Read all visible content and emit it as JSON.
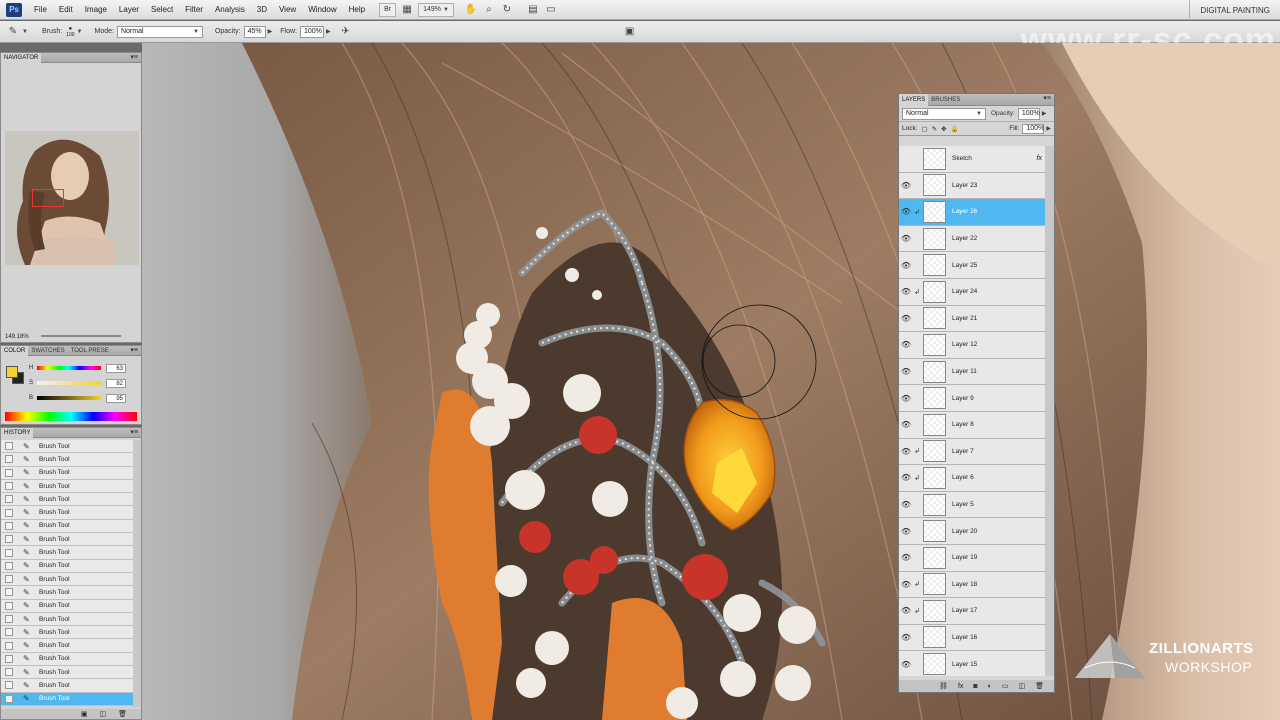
{
  "app": {
    "logo": "Ps",
    "workspace": "DIGITAL PAINTING",
    "watermark": "www.rr-sc.com"
  },
  "menu": [
    "File",
    "Edit",
    "Image",
    "Layer",
    "Select",
    "Filter",
    "Analysis",
    "3D",
    "View",
    "Window",
    "Help"
  ],
  "menubar_controls": {
    "br": "Br",
    "zoom": "149%"
  },
  "options": {
    "brush_label": "Brush:",
    "brush_size": "100",
    "mode_label": "Mode:",
    "mode_value": "Normal",
    "opacity_label": "Opacity:",
    "opacity_value": "45%",
    "flow_label": "Flow:",
    "flow_value": "100%"
  },
  "navigator": {
    "title": "NAVIGATOR",
    "zoom": "149.18%"
  },
  "color_panel": {
    "tabs": [
      "COLOR",
      "SWATCHES",
      "TOOL PRESE"
    ],
    "h_label": "H",
    "h_value": "63",
    "s_label": "S",
    "s_value": "82",
    "b_label": "B",
    "b_value": "95",
    "foreground": "#f5d130",
    "background": "#222222"
  },
  "history": {
    "title": "HISTORY",
    "items": [
      "Brush Tool",
      "Brush Tool",
      "Brush Tool",
      "Brush Tool",
      "Brush Tool",
      "Brush Tool",
      "Brush Tool",
      "Brush Tool",
      "Brush Tool",
      "Brush Tool",
      "Brush Tool",
      "Brush Tool",
      "Brush Tool",
      "Brush Tool",
      "Brush Tool",
      "Brush Tool",
      "Brush Tool",
      "Brush Tool",
      "Brush Tool",
      "Brush Tool"
    ],
    "selected_index": 19
  },
  "layers_panel": {
    "tabs": [
      "LAYERS",
      "BRUSHES"
    ],
    "blend_mode": "Normal",
    "opacity_label": "Opacity:",
    "opacity_value": "100%",
    "lock_label": "Lock:",
    "fill_label": "Fill:",
    "fill_value": "100%",
    "layers": [
      {
        "name": "Sketch",
        "visible": false,
        "clipped": false,
        "fx": "fx"
      },
      {
        "name": "Layer 23",
        "visible": true,
        "clipped": false,
        "fx": ""
      },
      {
        "name": "Layer 26",
        "visible": true,
        "clipped": true,
        "fx": "",
        "selected": true
      },
      {
        "name": "Layer 22",
        "visible": true,
        "clipped": false,
        "fx": ""
      },
      {
        "name": "Layer 25",
        "visible": true,
        "clipped": false,
        "fx": ""
      },
      {
        "name": "Layer 24",
        "visible": true,
        "clipped": true,
        "fx": ""
      },
      {
        "name": "Layer 21",
        "visible": true,
        "clipped": false,
        "fx": ""
      },
      {
        "name": "Layer 12",
        "visible": true,
        "clipped": false,
        "fx": ""
      },
      {
        "name": "Layer 11",
        "visible": true,
        "clipped": false,
        "fx": ""
      },
      {
        "name": "Layer 9",
        "visible": true,
        "clipped": false,
        "fx": ""
      },
      {
        "name": "Layer 8",
        "visible": true,
        "clipped": false,
        "fx": ""
      },
      {
        "name": "Layer 7",
        "visible": true,
        "clipped": true,
        "fx": ""
      },
      {
        "name": "Layer 6",
        "visible": true,
        "clipped": true,
        "fx": ""
      },
      {
        "name": "Layer 5",
        "visible": true,
        "clipped": false,
        "fx": ""
      },
      {
        "name": "Layer 20",
        "visible": true,
        "clipped": false,
        "fx": ""
      },
      {
        "name": "Layer 19",
        "visible": true,
        "clipped": false,
        "fx": ""
      },
      {
        "name": "Layer 18",
        "visible": true,
        "clipped": true,
        "fx": ""
      },
      {
        "name": "Layer 17",
        "visible": true,
        "clipped": true,
        "fx": ""
      },
      {
        "name": "Layer 16",
        "visible": true,
        "clipped": false,
        "fx": ""
      },
      {
        "name": "Layer 15",
        "visible": true,
        "clipped": false,
        "fx": ""
      }
    ]
  },
  "brand": {
    "name": "ZILLIONARTS",
    "sub": "WORKSHOP"
  }
}
